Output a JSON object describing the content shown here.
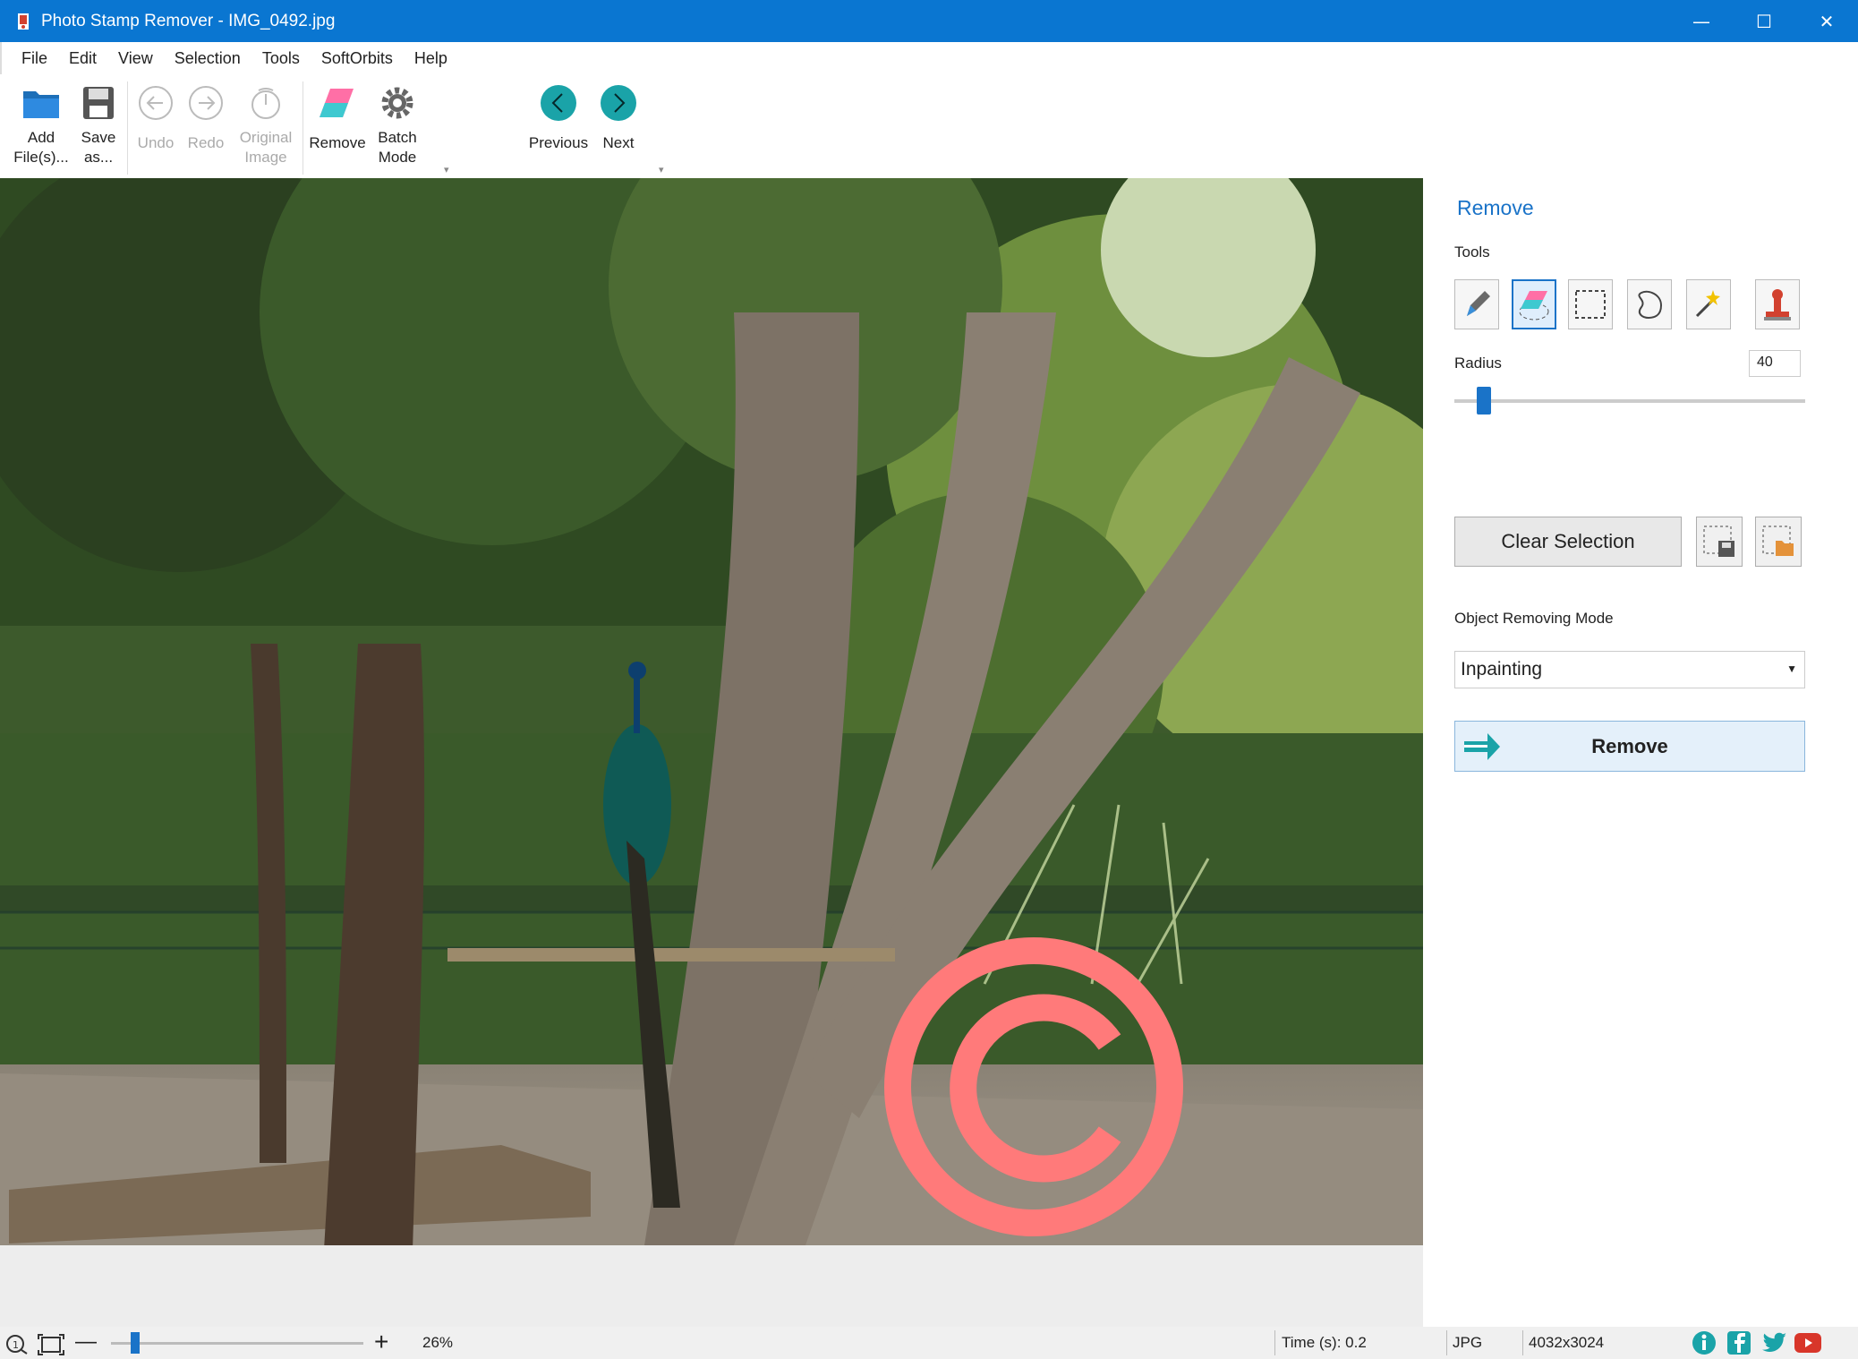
{
  "window": {
    "title": "Photo Stamp Remover - IMG_0492.jpg",
    "minimize": "—",
    "maximize": "☐",
    "close": "✕"
  },
  "menu": [
    "File",
    "Edit",
    "View",
    "Selection",
    "Tools",
    "SoftOrbits",
    "Help"
  ],
  "ribbon": {
    "add_files": [
      "Add",
      "File(s)..."
    ],
    "save_as": [
      "Save",
      "as..."
    ],
    "undo": "Undo",
    "redo": "Redo",
    "original_image": [
      "Original",
      "Image"
    ],
    "remove": "Remove",
    "batch_mode": [
      "Batch",
      "Mode"
    ],
    "previous": "Previous",
    "next": "Next"
  },
  "panel": {
    "title": "Remove",
    "tools_label": "Tools",
    "tools": [
      "pencil-icon",
      "eraser-icon",
      "rect-select-icon",
      "lasso-icon",
      "magic-wand-icon",
      "stamp-icon"
    ],
    "active_tool": "eraser-icon",
    "radius_label": "Radius",
    "radius_value": "40",
    "radius_max": 400,
    "clear_selection": "Clear Selection",
    "mode_label": "Object Removing Mode",
    "mode_value": "Inpainting",
    "remove_button": "Remove"
  },
  "status": {
    "zoom": "26%",
    "time": "Time (s): 0.2",
    "format": "JPG",
    "dimensions": "4032x3024"
  },
  "colors": {
    "accent": "#1a73c8",
    "titlebar": "#0a76d1",
    "stamp": "#ff7a7a",
    "teal": "#1aa3a8"
  }
}
